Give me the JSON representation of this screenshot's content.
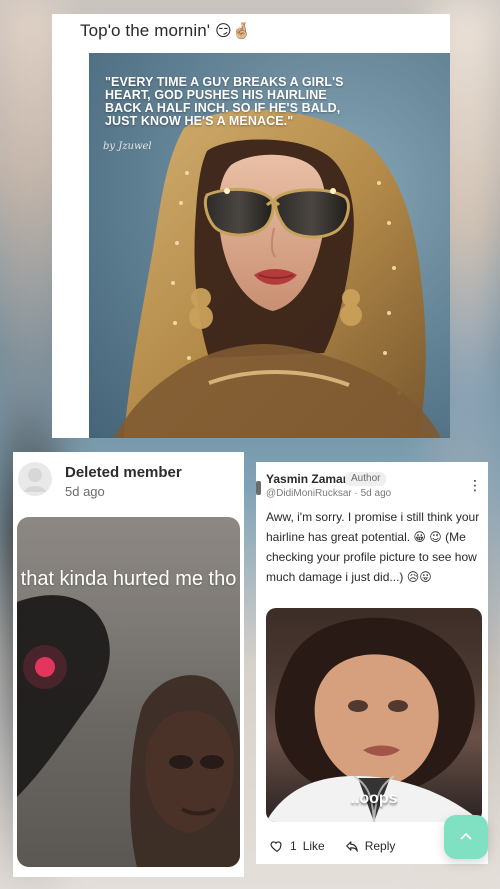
{
  "top_post": {
    "caption": "Top'o the mornin'",
    "caption_emoji": "😏🤞🏼",
    "quote": "\"EVERY TIME A GUY BREAKS A GIRL'S HEART, GOD PUSHES HIS HAIRLINE BACK A HALF INCH. SO IF HE'S BALD, JUST KNOW HE'S A MENACE.\"",
    "signature": "by Jzuwel"
  },
  "left_reply": {
    "name": "Deleted member",
    "time": "5d ago",
    "meme_text": "that kinda hurted me tho"
  },
  "right_reply": {
    "name": "Yasmin Zaman",
    "badge": "Author",
    "handle": "@DidiMoniRucksar · 5d ago",
    "text": "Aww, i'm sorry. I promise i still think your hairline has great potential. 😀 😉 (Me checking your profile picture to see how much damage i just did...) 😥😛",
    "image_caption": "..oops",
    "actions": {
      "like_count": "1",
      "like_label": "Like",
      "reply_label": "Reply"
    }
  },
  "icons": {
    "kebab": "kebab-icon",
    "heart": "heart-icon",
    "reply": "reply-icon",
    "fab": "chevron-up-icon",
    "avatar": "default-avatar-icon"
  },
  "colors": {
    "fab": "#7fe0c2",
    "card": "#ffffff"
  }
}
